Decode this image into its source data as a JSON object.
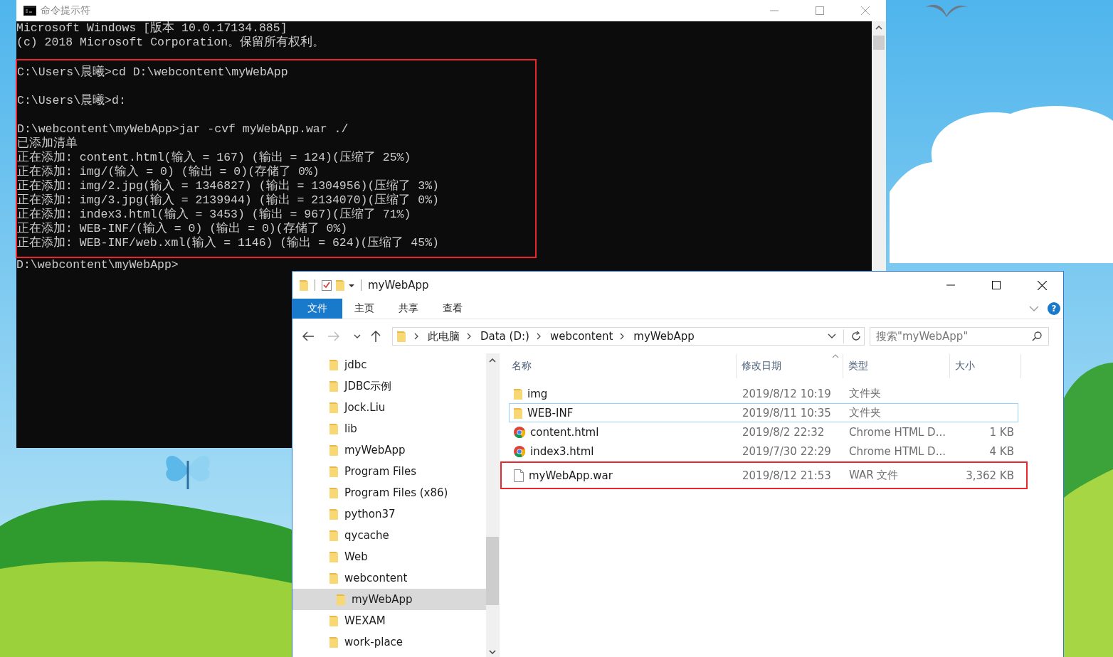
{
  "console_window": {
    "title": "命令提示符",
    "groups": [
      {
        "highlighted": false,
        "paragraphs": [
          [
            "Microsoft Windows [版本 10.0.17134.885]",
            "(c) 2018 Microsoft Corporation。保留所有权利。"
          ]
        ]
      },
      {
        "highlighted": true,
        "paragraphs": [
          [
            "C:\\Users\\晨曦>cd D:\\webcontent\\myWebApp"
          ],
          [
            "C:\\Users\\晨曦>d:"
          ],
          [
            "D:\\webcontent\\myWebApp>jar -cvf myWebApp.war ./",
            "已添加清单",
            "正在添加: content.html(输入 = 167) (输出 = 124)(压缩了 25%)",
            "正在添加: img/(输入 = 0) (输出 = 0)(存储了 0%)",
            "正在添加: img/2.jpg(输入 = 1346827) (输出 = 1304956)(压缩了 3%)",
            "正在添加: img/3.jpg(输入 = 2139944) (输出 = 2134070)(压缩了 0%)",
            "正在添加: index3.html(输入 = 3453) (输出 = 967)(压缩了 71%)",
            "正在添加: WEB-INF/(输入 = 0) (输出 = 0)(存储了 0%)",
            "正在添加: WEB-INF/web.xml(输入 = 1146) (输出 = 624)(压缩了 45%)"
          ]
        ]
      },
      {
        "highlighted": false,
        "paragraphs": [
          [
            "D:\\webcontent\\myWebApp>"
          ]
        ]
      }
    ]
  },
  "explorer_window": {
    "title": "myWebApp",
    "ribbon_tabs": [
      {
        "label": "文件",
        "kind": "file_menu"
      },
      {
        "label": "主页",
        "kind": "tab"
      },
      {
        "label": "共享",
        "kind": "tab"
      },
      {
        "label": "查看",
        "kind": "tab"
      }
    ],
    "help": "?",
    "breadcrumb": [
      "此电脑",
      "Data (D:)",
      "webcontent",
      "myWebApp"
    ],
    "search": {
      "placeholder": "搜索\"myWebApp\""
    },
    "sidebar": {
      "items": [
        {
          "label": "jdbc",
          "selected": false
        },
        {
          "label": "JDBC示例",
          "selected": false
        },
        {
          "label": "Jock.Liu",
          "selected": false
        },
        {
          "label": "lib",
          "selected": false
        },
        {
          "label": "myWebApp",
          "selected": false
        },
        {
          "label": "Program Files",
          "selected": false
        },
        {
          "label": "Program Files (x86)",
          "selected": false
        },
        {
          "label": "python37",
          "selected": false
        },
        {
          "label": "qycache",
          "selected": false
        },
        {
          "label": "Web",
          "selected": false
        },
        {
          "label": "webcontent",
          "selected": false,
          "children": [
            {
              "label": "myWebApp",
              "selected": true
            }
          ]
        },
        {
          "label": "WEXAM",
          "selected": false
        },
        {
          "label": "work-place",
          "selected": false
        }
      ]
    },
    "columns": [
      "名称",
      "修改日期",
      "类型",
      "大小"
    ],
    "files": [
      {
        "name": "img",
        "date": "2019/8/12 10:19",
        "type": "文件夹",
        "kind": "folder",
        "focused": false,
        "highlighted": false
      },
      {
        "name": "WEB-INF",
        "date": "2019/8/11 10:35",
        "type": "文件夹",
        "kind": "folder",
        "focused": true,
        "highlighted": false
      },
      {
        "name": "content.html",
        "date": "2019/8/2 22:32",
        "type": "Chrome HTML D...",
        "size": "1 KB",
        "kind": "chrome",
        "focused": false,
        "highlighted": false
      },
      {
        "name": "index3.html",
        "date": "2019/7/30 22:29",
        "type": "Chrome HTML D...",
        "size": "4 KB",
        "kind": "chrome",
        "focused": false,
        "highlighted": false
      },
      {
        "name": "myWebApp.war",
        "date": "2019/8/12 21:53",
        "type": "WAR 文件",
        "size": "3,362 KB",
        "kind": "file",
        "focused": false,
        "highlighted": true
      }
    ]
  }
}
